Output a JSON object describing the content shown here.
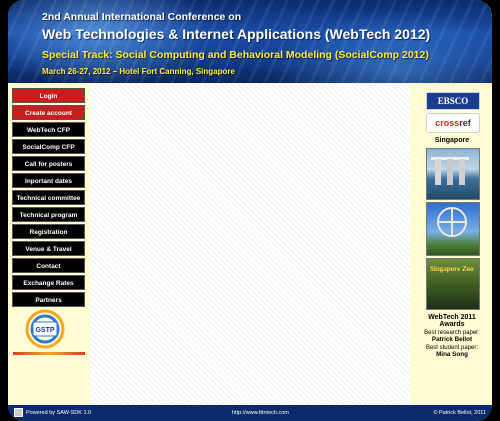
{
  "banner": {
    "line1": "2nd Annual International Conference on",
    "line2": "Web Technologies & Internet Applications (WebTech 2012)",
    "line3": "Special Track: Social Computing and Behavioral Modeling (SocialComp 2012)",
    "line4": "March 26-27, 2012 – Hotel Fort Canning, Singapore"
  },
  "nav": {
    "items": [
      {
        "label": "Login"
      },
      {
        "label": "Create account"
      },
      {
        "label": "WebTech CFP"
      },
      {
        "label": "SocialComp CFP"
      },
      {
        "label": "Call for posters"
      },
      {
        "label": "Inportant dates"
      },
      {
        "label": "Technical committee"
      },
      {
        "label": "Technical program"
      },
      {
        "label": "Registration"
      },
      {
        "label": "Venue & Travel"
      },
      {
        "label": "Contact"
      },
      {
        "label": "Exchange Rates"
      },
      {
        "label": "Partners"
      }
    ]
  },
  "sidebar_right": {
    "ebsco": "EBSCO",
    "crossref_a": "cross",
    "crossref_b": "ref",
    "singapore": "Singapore",
    "zoo_text": "Singapore Zoo",
    "awards_title": "WebTech 2011 Awards",
    "research_label": "Best research paper:",
    "research_name": "Patrick Bellot",
    "student_label": "Best student paper:",
    "student_name": "Mina Song"
  },
  "footer": {
    "left": "Powered by SAW-SDK 1.0",
    "mid": "http://www.tttntech.com",
    "right": "© Patrick Bellot, 2011"
  },
  "colors": {
    "red_buttons": "#c81d1d",
    "banner_blue": "#1a4ea8",
    "background": "#fffbd2"
  }
}
